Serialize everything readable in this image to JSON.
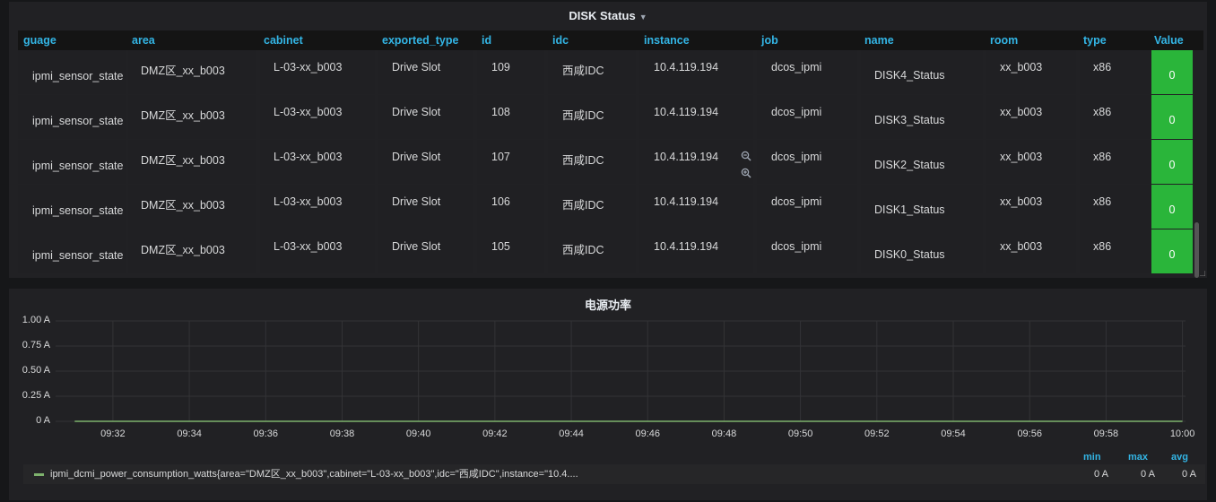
{
  "disk_panel": {
    "title": "DISK Status",
    "columns": [
      "guage",
      "area",
      "cabinet",
      "exported_type",
      "id",
      "idc",
      "instance",
      "job",
      "name",
      "room",
      "type",
      "Value"
    ],
    "rows": [
      {
        "guage": "ipmi_sensor_state",
        "area": "DMZ区_xx_b003",
        "cabinet": "L-03-xx_b003",
        "exported_type": "Drive Slot",
        "id": "109",
        "idc": "西咸IDC",
        "instance": "10.4.119.194",
        "job": "dcos_ipmi",
        "name": "DISK4_Status",
        "room": "xx_b003",
        "type": "x86",
        "value": "0"
      },
      {
        "guage": "ipmi_sensor_state",
        "area": "DMZ区_xx_b003",
        "cabinet": "L-03-xx_b003",
        "exported_type": "Drive Slot",
        "id": "108",
        "idc": "西咸IDC",
        "instance": "10.4.119.194",
        "job": "dcos_ipmi",
        "name": "DISK3_Status",
        "room": "xx_b003",
        "type": "x86",
        "value": "0"
      },
      {
        "guage": "ipmi_sensor_state",
        "area": "DMZ区_xx_b003",
        "cabinet": "L-03-xx_b003",
        "exported_type": "Drive Slot",
        "id": "107",
        "idc": "西咸IDC",
        "instance": "10.4.119.194",
        "job": "dcos_ipmi",
        "name": "DISK2_Status",
        "room": "xx_b003",
        "type": "x86",
        "value": "0"
      },
      {
        "guage": "ipmi_sensor_state",
        "area": "DMZ区_xx_b003",
        "cabinet": "L-03-xx_b003",
        "exported_type": "Drive Slot",
        "id": "106",
        "idc": "西咸IDC",
        "instance": "10.4.119.194",
        "job": "dcos_ipmi",
        "name": "DISK1_Status",
        "room": "xx_b003",
        "type": "x86",
        "value": "0"
      },
      {
        "guage": "ipmi_sensor_state",
        "area": "DMZ区_xx_b003",
        "cabinet": "L-03-xx_b003",
        "exported_type": "Drive Slot",
        "id": "105",
        "idc": "西咸IDC",
        "instance": "10.4.119.194",
        "job": "dcos_ipmi",
        "name": "DISK0_Status",
        "room": "xx_b003",
        "type": "x86",
        "value": "0"
      }
    ],
    "value_color": "#2ab53a",
    "header_color": "#33b5e5"
  },
  "power_panel": {
    "title": "电源功率",
    "legend": {
      "headers": [
        "min",
        "max",
        "avg"
      ],
      "series_label": "ipmi_dcmi_power_consumption_watts{area=\"DMZ区_xx_b003\",cabinet=\"L-03-xx_b003\",idc=\"西咸IDC\",instance=\"10.4....",
      "min": "0 A",
      "max": "0 A",
      "avg": "0 A",
      "series_color": "#7eb26d"
    }
  },
  "chart_data": {
    "type": "line",
    "title": "电源功率",
    "xlabel": "",
    "ylabel": "",
    "y_ticks": [
      "1.00 A",
      "0.75 A",
      "0.50 A",
      "0.25 A",
      "0 A"
    ],
    "x_ticks": [
      "09:32",
      "09:34",
      "09:36",
      "09:38",
      "09:40",
      "09:42",
      "09:44",
      "09:46",
      "09:48",
      "09:50",
      "09:52",
      "09:54",
      "09:56",
      "09:58",
      "10:00"
    ],
    "ylim": [
      0,
      1
    ],
    "grid": true,
    "series": [
      {
        "name": "ipmi_dcmi_power_consumption_watts{area=\"DMZ区_xx_b003\",cabinet=\"L-03-xx_b003\",idc=\"西咸IDC\",instance=\"10.4....",
        "color": "#7eb26d",
        "x": [
          "09:31",
          "10:00"
        ],
        "values": [
          0,
          0
        ]
      }
    ]
  }
}
